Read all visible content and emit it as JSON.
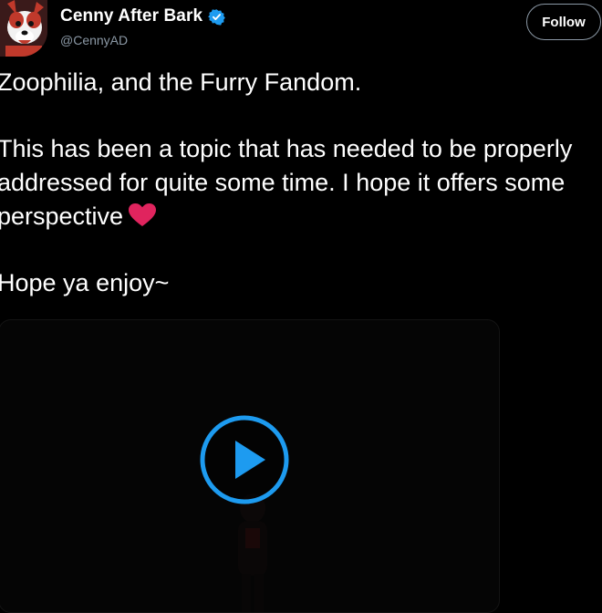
{
  "author": {
    "display_name": "Cenny After Bark",
    "handle": "@CennyAD",
    "verified": true
  },
  "follow_button": {
    "label": "Follow"
  },
  "tweet": {
    "lines": [
      "Zoophilia, and the Furry Fandom.",
      "This has been a topic that has needed to be properly addressed for quite some time. I hope it offers some perspective",
      "Hope ya enjoy~"
    ],
    "emoji": "heart-emoji"
  },
  "media": {
    "type": "video",
    "play_icon": "play-icon"
  },
  "colors": {
    "background": "#000000",
    "text": "#ffffff",
    "secondary_text": "#8b98a5",
    "accent_blue": "#1d9bf0",
    "heart_red": "#e0245e"
  }
}
